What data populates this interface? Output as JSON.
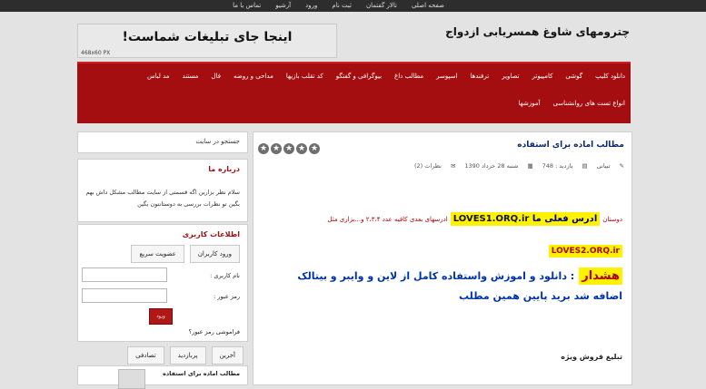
{
  "topbar": {
    "links": [
      "صفحه اصلی",
      "تالار گفتمان",
      "ثبت نام",
      "ورود",
      "آرشیو",
      "تماس با ما"
    ]
  },
  "header": {
    "site_title": "چترومهای شاوغ همسریابی ازدواج",
    "ad_text": "اینجا جای تبلیغات شماست!",
    "ad_size": "468x60 PX"
  },
  "nav": {
    "row1": [
      "دانلود کلیپ",
      "گوشی",
      "کامپیوتر",
      "تصاویر",
      "ترفندها",
      "اسپوسر",
      "مطالب داغ",
      "بیوگرافی و گفتگو",
      "کد تقلب بازیها",
      "مداحی و روضه",
      "فال",
      "مستند",
      "مد لباس"
    ],
    "row2": [
      "انواع تست های روانشناسی",
      "آموزشها"
    ]
  },
  "sidebar": {
    "search_placeholder": "جستجو در سایت",
    "about_title": "درباره ما",
    "about_text": "سلام نظر بزارین اگه قسمتی از سایت مطالب مشکل داش بهم بگین تو نظرات بررسی به دوستانتون بگین",
    "login_title": "اطلاعات کاربری",
    "tab_login": "ورود کاربران",
    "tab_register": "عضویت سریع",
    "username_label": "نام کاربری :",
    "password_label": "رمز عبور :",
    "login_button": "ورود",
    "forgot": "فراموشی رمز عبور؟",
    "posts_tabs": [
      "آخرین",
      "پربازدید",
      "تصادفی"
    ],
    "recent_post_title": "مطالب اماده برای استفاده"
  },
  "post": {
    "title": "مطالب اماده برای استفاده",
    "author": "تبیانی",
    "views_label": "بازدید : 748",
    "date": "شنبه 28 خرداد 1390",
    "comments": "نظرات (2)",
    "line1_prefix": "دوستان",
    "line1_label": "ادرس فعلی ما",
    "line1_url": "LOVES1.ORQ.ir",
    "line1_suffix": "ادرسهای بعدی کافیه عدد ۲،۳،۴ و...بزاری مثل",
    "line2_url": "LOVES2.ORQ.ir",
    "warning_word": "هشدار",
    "warning_text": ": دانلود و اموزش واستفاده کامل از لاین و وایبر و بیتالک اضافه شد برید پایین همین مطلب",
    "special_ad": "تبلیغ فروش ویژه"
  },
  "rating": {
    "stars": 5
  }
}
